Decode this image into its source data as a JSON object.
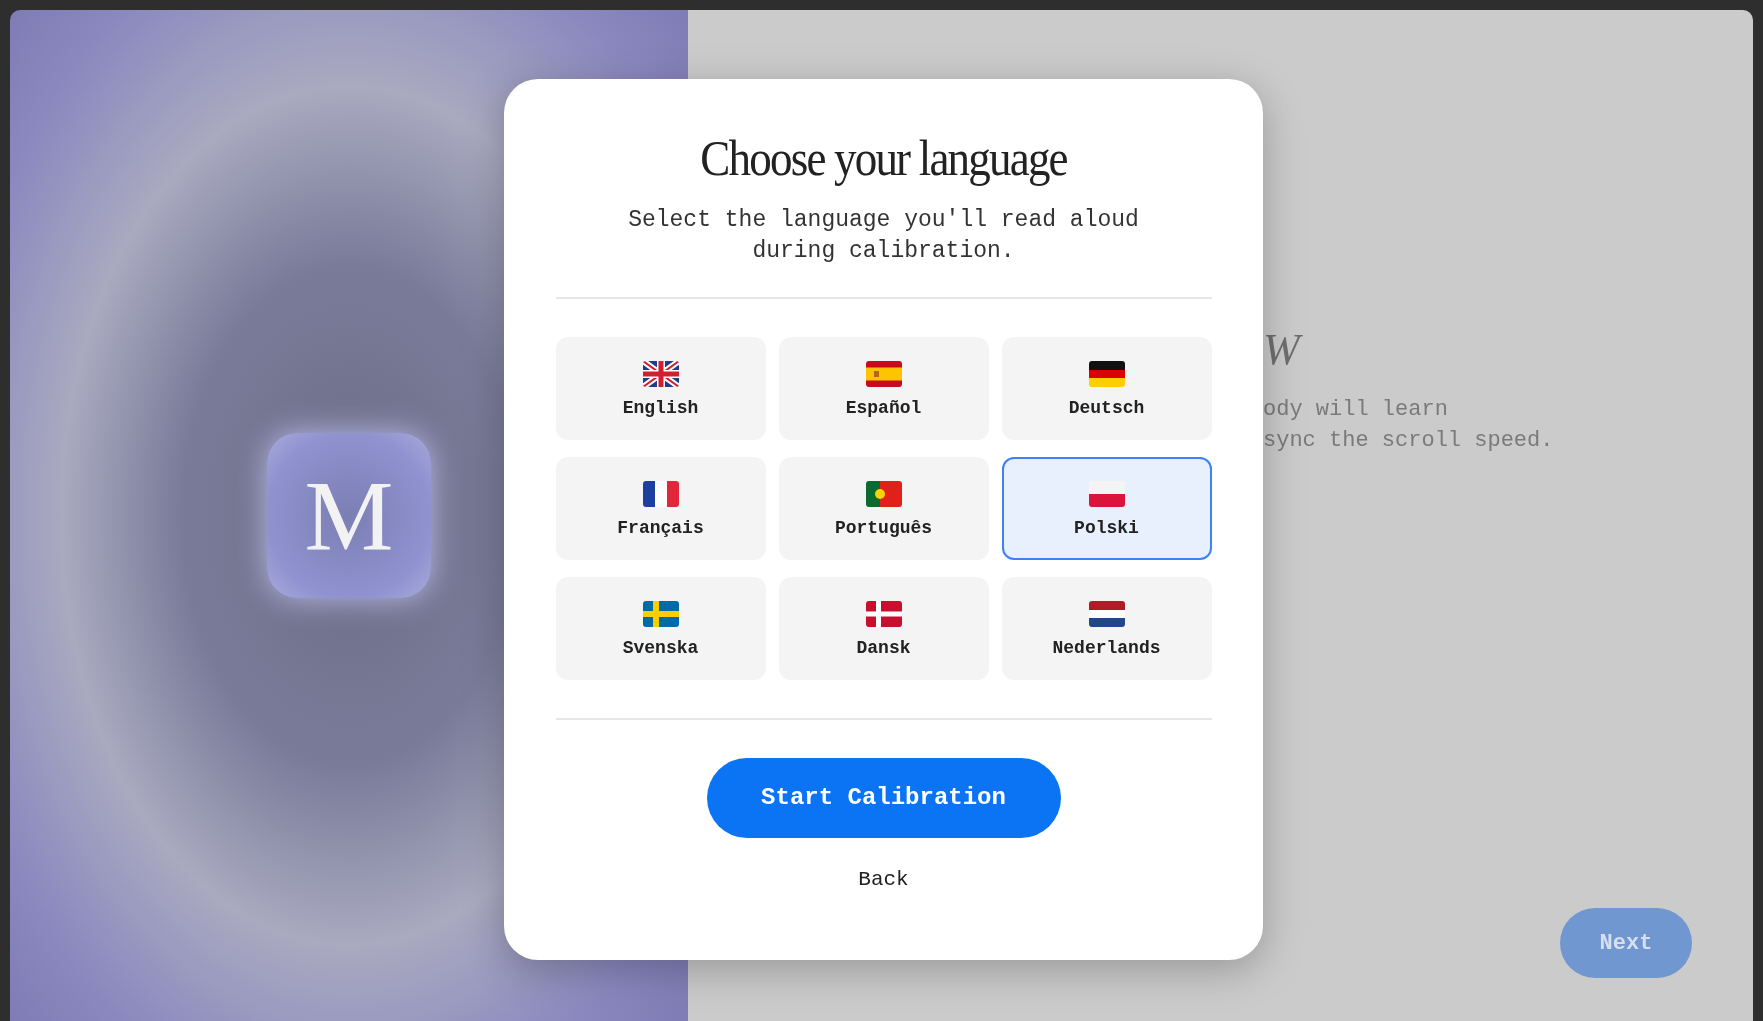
{
  "logo": {
    "letter": "M"
  },
  "background_panel": {
    "heading": "W",
    "body_lines": [
      "ody will learn",
      "sync the scroll speed."
    ],
    "next_button": "Next"
  },
  "dialog": {
    "title": "Choose your language",
    "subtitle": "Select the language you'll read aloud during calibration.",
    "languages": [
      {
        "label": "English",
        "selected": false
      },
      {
        "label": "Español",
        "selected": false
      },
      {
        "label": "Deutsch",
        "selected": false
      },
      {
        "label": "Français",
        "selected": false
      },
      {
        "label": "Português",
        "selected": false
      },
      {
        "label": "Polski",
        "selected": true
      },
      {
        "label": "Svenska",
        "selected": false
      },
      {
        "label": "Dansk",
        "selected": false
      },
      {
        "label": "Nederlands",
        "selected": false
      }
    ],
    "primary_button": "Start Calibration",
    "back_link": "Back"
  }
}
